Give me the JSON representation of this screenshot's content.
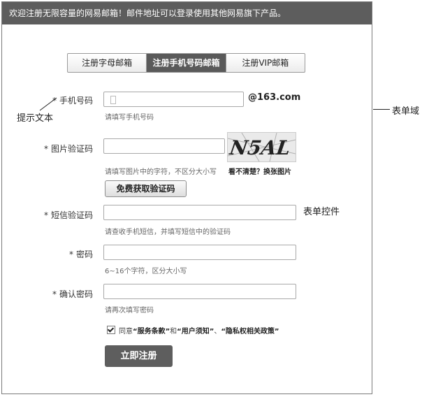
{
  "banner": {
    "text": "欢迎注册无限容量的网易邮箱！邮件地址可以登录使用其他网易旗下产品。"
  },
  "tabs": [
    {
      "label": "注册字母邮箱",
      "active": false
    },
    {
      "label": "注册手机号码邮箱",
      "active": true
    },
    {
      "label": "注册VIP邮箱",
      "active": false
    }
  ],
  "form": {
    "phone": {
      "label": "手机号码",
      "hint": "请填写手机号码",
      "suffix": "@163.com"
    },
    "captcha": {
      "label": "图片验证码",
      "hint": "请填写图片中的字符，不区分大小写",
      "image_text": "N5AL",
      "refresh_label": "看不清楚？换张图片"
    },
    "sms_button": "免费获取验证码",
    "sms": {
      "label": "短信验证码",
      "hint": "请查收手机短信，并填写短信中的验证码"
    },
    "password": {
      "label": "密码",
      "hint": "6~16个字符，区分大小写"
    },
    "confirm": {
      "label": "确认密码",
      "hint": "请再次填写密码"
    },
    "agreement": {
      "prefix": "同意",
      "term1": "“服务条款”",
      "joiner1": "和",
      "term2": "“用户须知”",
      "joiner2": "、",
      "term3": "“隐私权相关政策”",
      "checked": true
    },
    "submit": "立即注册",
    "required_mark": "*"
  },
  "annotations": {
    "hint_text": "提示文本",
    "form_control": "表单控件",
    "form_field": "表单域"
  }
}
